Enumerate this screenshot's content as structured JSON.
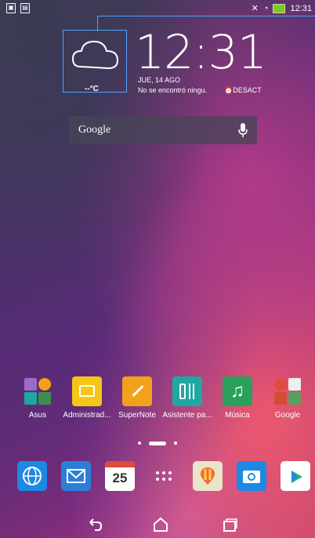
{
  "status_bar": {
    "time": "12:31"
  },
  "clock_widget": {
    "time": "12:31",
    "date": "JUE, 14 AGO",
    "location": "No se encontró ningu.",
    "alarm": "DESACT",
    "temperature": "--°C"
  },
  "search": {
    "label": "Google"
  },
  "apps": [
    {
      "label": "Asus"
    },
    {
      "label": "Administrad..."
    },
    {
      "label": "SuperNote"
    },
    {
      "label": "Asistente pa..."
    },
    {
      "label": "Música"
    },
    {
      "label": "Google"
    }
  ],
  "dock": {
    "calendar_day": "25",
    "items": [
      "browser-icon",
      "email-icon",
      "calendar-icon",
      "app-drawer-icon",
      "maps-icon",
      "camera-icon",
      "play-store-icon"
    ]
  },
  "colors": {
    "accent_blue": "#4fa3ff",
    "file_manager": "#f5c518",
    "supernote": "#f2a21a",
    "assistant": "#1fa7a0",
    "music": "#2aa05a"
  }
}
